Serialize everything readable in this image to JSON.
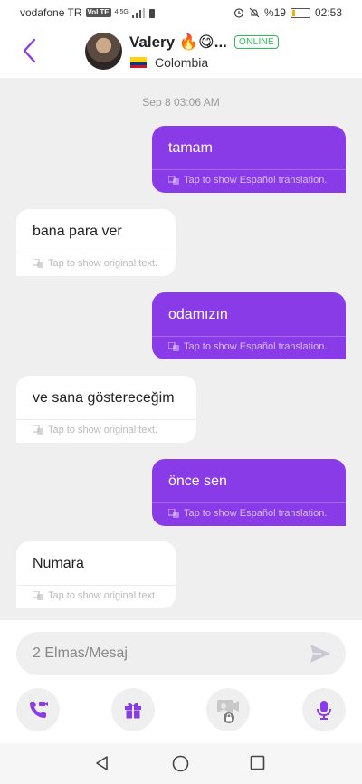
{
  "status_bar": {
    "carrier": "vodafone TR",
    "volte": "VoLTE",
    "network": "4.5G",
    "battery_percent_label": "%19",
    "battery_level": 0.19,
    "time": "02:53"
  },
  "header": {
    "name": "Valery 🔥😋...",
    "status": "ONLINE",
    "country": "Colombia"
  },
  "chat": {
    "date": "Sep 8 03:06 AM",
    "messages": [
      {
        "side": "me",
        "text": "tamam",
        "sub": "Tap to show Español translation."
      },
      {
        "side": "them",
        "text": "bana para ver",
        "sub": "Tap to show original text."
      },
      {
        "side": "me",
        "text": "odamızın",
        "sub": "Tap to show Español translation."
      },
      {
        "side": "them",
        "text": "ve sana göstereceğim",
        "sub": "Tap to show original text."
      },
      {
        "side": "me",
        "text": "önce sen",
        "sub": "Tap to show Español translation."
      },
      {
        "side": "them",
        "text": "Numara",
        "sub": "Tap to show original text."
      }
    ]
  },
  "composer": {
    "placeholder": "2 Elmas/Mesaj"
  },
  "colors": {
    "accent": "#8a3be8",
    "online": "#2ebd5b",
    "chat_bg": "#efefef"
  },
  "icons": {
    "back": "chevron-left-icon",
    "send": "send-icon",
    "video_call": "video-call-icon",
    "gift": "gift-icon",
    "private_video": "locked-video-icon",
    "mic": "microphone-icon"
  }
}
